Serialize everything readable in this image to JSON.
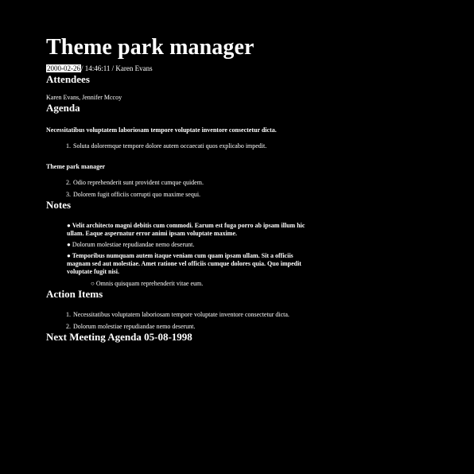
{
  "header": {
    "title": "Theme park manager",
    "date": "2000-02-26",
    "time_author": "/ 14:46:11 / Karen Evans"
  },
  "attendees": {
    "heading": "Attendees",
    "names": "Karen Evans, Jennifer Mccoy"
  },
  "agenda": {
    "heading": "Agenda",
    "lead": "Necessitatibus voluptatem laboriosam tempore voluptate inventore consectetur dicta.",
    "items1": [
      {
        "num": "1.",
        "text": "Soluta doloremque tempore dolore autem occaecati quos explicabo impedit."
      }
    ],
    "subheading": "Theme park manager",
    "items2": [
      {
        "num": "2.",
        "text": "Odio reprehenderit sunt provident cumque quidem."
      },
      {
        "num": "3.",
        "text": "Dolorem fugit officiis corrupti quo maxime sequi."
      }
    ]
  },
  "notes": {
    "heading": "Notes",
    "bullets": [
      {
        "marker": "●",
        "text": "Velit architecto magni debitis cum commodi. Earum est fuga porro ab ipsam illum hic ullam. Eaque aspernatur error animi ipsam voluptate maxime.",
        "bold": true
      },
      {
        "marker": "●",
        "text": "Dolorum molestiae repudiandae nemo deserunt.",
        "bold": false
      },
      {
        "marker": "●",
        "text": "Temporibus numquam autem itaque veniam cum quam ipsam ullam. Sit a officiis magnam sed aut molestiae. Amet ratione vel officiis cumque dolores quia. Quo impedit voluptate fugit nisi.",
        "bold": true
      }
    ],
    "sub_bullet": {
      "marker": "○",
      "text": "Omnis quisquam reprehenderit vitae eum."
    }
  },
  "action_items": {
    "heading": "Action Items",
    "items": [
      {
        "num": "1.",
        "text": "Necessitatibus voluptatem laboriosam tempore voluptate inventore consectetur dicta."
      },
      {
        "num": "2.",
        "text": "Dolorum molestiae repudiandae nemo deserunt."
      }
    ]
  },
  "next_meeting": {
    "heading": "Next Meeting Agenda 05-08-1998"
  },
  "colors": {
    "background": "#000000",
    "text": "#ffffff"
  }
}
